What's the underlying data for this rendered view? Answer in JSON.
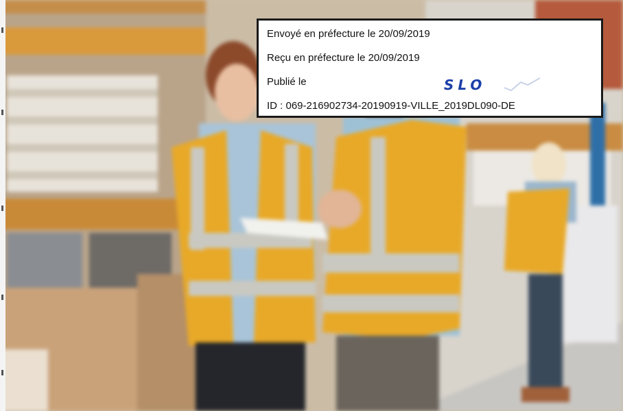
{
  "stamp": {
    "sent_line": "Envoyé en préfecture le 20/09/2019",
    "received_line": "Reçu en préfecture le 20/09/2019",
    "published_line": "Publié le",
    "id_line": "ID : 069-216902734-20190919-VILLE_2019DL090-DE",
    "logo_text": "SLO"
  },
  "colors": {
    "vest": "#e8a928",
    "reflective": "#c9c9c2",
    "stamp_border": "#1a1a1a",
    "logo_blue": "#1c3fa8"
  },
  "icons": [
    "slo-logo-icon"
  ]
}
